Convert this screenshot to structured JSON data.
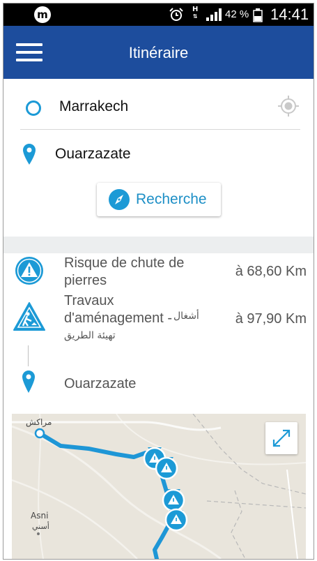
{
  "status_bar": {
    "logo_letter": "m",
    "network_type": "H",
    "battery": "42 %",
    "time": "14:41"
  },
  "app_bar": {
    "title": "Itinéraire",
    "menu_icon": "hamburger-icon"
  },
  "search_form": {
    "origin": "Marrakech",
    "destination": "Ouarzazate",
    "search_button": "Recherche",
    "accent_color": "#1c9ad6"
  },
  "results": [
    {
      "icon": "warning-triangle-icon",
      "label": "Risque de chute de pierres",
      "distance": "à 68,60 Km"
    },
    {
      "icon": "roadwork-icon",
      "label": "Travaux d'aménagement -",
      "label_ar_1": "أشغال",
      "label_ar_2": "تهيئة الطريق",
      "distance": "à 97,90 Km"
    },
    {
      "icon": "map-pin-icon",
      "label": "Ouarzazate"
    }
  ],
  "map": {
    "city_main": "مراكش",
    "city_small": "Asni",
    "city_small_ar": "أسني",
    "route_color": "#1e96d6"
  }
}
